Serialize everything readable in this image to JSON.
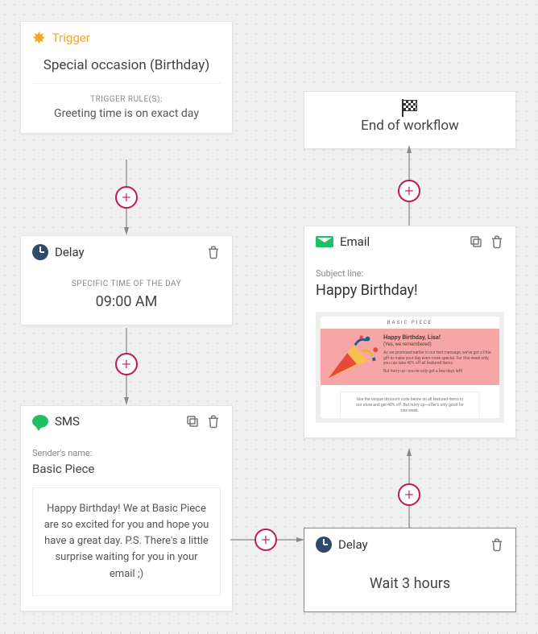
{
  "trigger": {
    "label": "Trigger",
    "title": "Special occasion (Birthday)",
    "rules_header": "TRIGGER RULE(S):",
    "rule": "Greeting time is on exact day"
  },
  "delay1": {
    "label": "Delay",
    "subhead": "SPECIFIC TIME OF THE DAY",
    "time": "09:00 AM"
  },
  "sms": {
    "label": "SMS",
    "sender_label": "Sender's name:",
    "sender": "Basic Piece",
    "body": "Happy Birthday! We at Basic Piece are so excited for you and hope you have a great day. P.S. There's a little surprise waiting for you in your email ;)"
  },
  "delay2": {
    "label": "Delay",
    "wait": "Wait 3 hours"
  },
  "email": {
    "label": "Email",
    "subject_label": "Subject line:",
    "subject": "Happy Birthday!",
    "preview": {
      "brand": "BASIC PIECE",
      "headline": "Happy Birthday, Lisa!",
      "subheadline": "(Yes, we remembered)",
      "hero_copy": "As we promised earlier in our text message, we've got a little gift to make your day even more special. For this week only, you can take 40% off all featured items.",
      "hero_footer": "But hurry up—you've only got a few days left!",
      "body_copy": "Use the unique discount code below on all featured items in our store and get 40% off. But hurry up—offer's only good for one week."
    }
  },
  "end": {
    "label": "End of workflow"
  }
}
